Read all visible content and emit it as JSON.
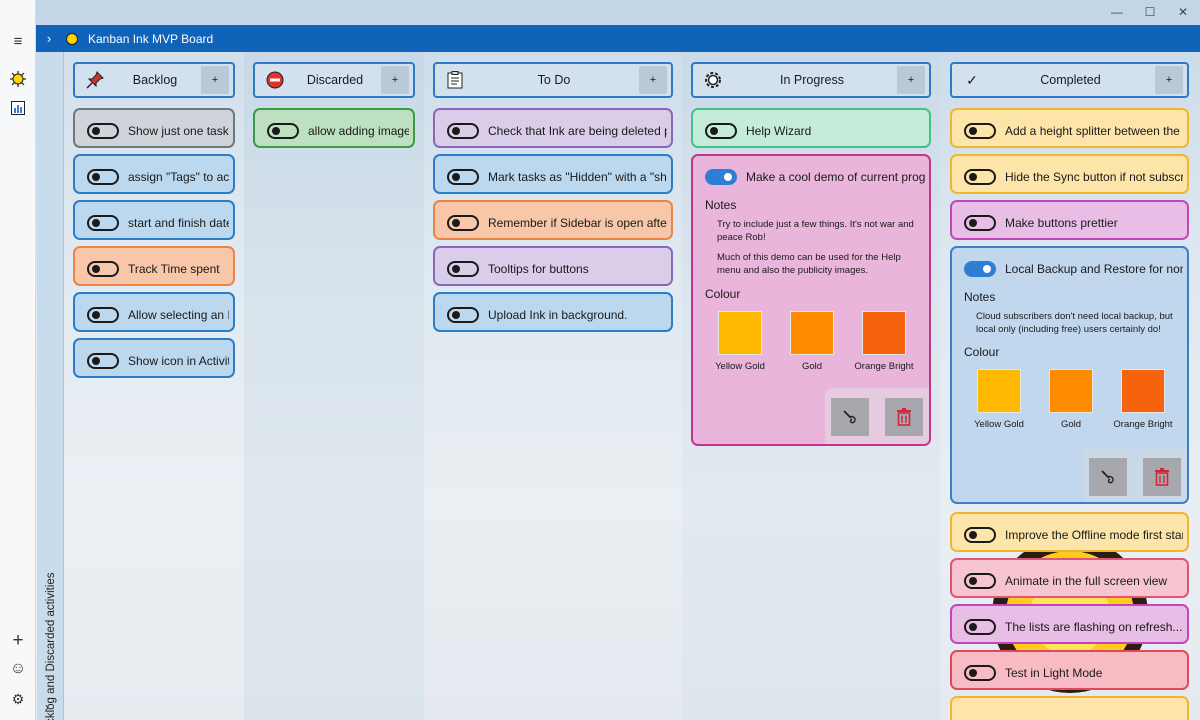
{
  "app": {
    "title": "Kanban Ink MVP Board"
  },
  "window_controls": {
    "minimize": "—",
    "maximize": "☐",
    "close": "✕"
  },
  "rail": {
    "menu_icon": "≡",
    "board_icon": "sun-icon",
    "chart_icon": "📊",
    "add_icon": "+",
    "emoji_icon": "☺",
    "settings_icon": "⚙"
  },
  "sidebar": {
    "label": "Backlog and Discarded activities",
    "chevron": "›"
  },
  "columns": {
    "backlog": {
      "title": "Backlog",
      "icon": "pin-icon",
      "add": "+"
    },
    "discarded": {
      "title": "Discarded",
      "icon": "no-entry-icon",
      "add": "+"
    },
    "todo": {
      "title": "To Do",
      "icon": "clipboard-icon",
      "add": "+"
    },
    "inprogress": {
      "title": "In Progress",
      "icon": "gear-icon",
      "add": "+"
    },
    "completed": {
      "title": "Completed",
      "icon": "✓",
      "add": "+"
    }
  },
  "backlog": [
    "Show just one task c",
    "assign \"Tags\" to acti",
    "start and finish dates",
    "Track Time spent",
    "Allow selecting an Ic",
    "Show icon in Activity"
  ],
  "discarded": [
    "allow adding images"
  ],
  "todo": [
    "Check that Ink are being deleted pro",
    "Mark tasks as \"Hidden\" with a \"show",
    "Remember if Sidebar is open after na",
    "Tooltips for buttons",
    "Upload Ink in background."
  ],
  "inprogress": {
    "task1": "Help Wizard",
    "task2": {
      "title": "Make a cool demo of current progres",
      "notes_label": "Notes",
      "notes_p1": "Try to include just a few things. It's not war and peace Rob!",
      "notes_p2": "Much of this demo can be used for the Help menu and also the publicity images.",
      "colour_label": "Colour",
      "swatches": [
        {
          "name": "Yellow Gold",
          "color": "#ffb900"
        },
        {
          "name": "Gold",
          "color": "#ff8c00"
        },
        {
          "name": "Orange Bright",
          "color": "#f7630c"
        }
      ]
    }
  },
  "completed": {
    "task1": "Add a height splitter between the ba",
    "task2": "Hide the Sync button if not subscribe",
    "task3": "Make buttons prettier",
    "task4": {
      "title": "Local Backup and Restore for non clc",
      "notes_label": "Notes",
      "notes_text": "Cloud subscribers don't need local backup, but local only (including free) users certainly do!",
      "colour_label": "Colour",
      "swatches": [
        {
          "name": "Yellow Gold",
          "color": "#ffb900"
        },
        {
          "name": "Gold",
          "color": "#ff8c00"
        },
        {
          "name": "Orange Bright",
          "color": "#f7630c"
        }
      ]
    },
    "task5": "Improve the Offline mode first start",
    "task6": "Animate in the full screen view",
    "task7": "The lists are flashing on refresh... fix t",
    "task8": "Test in Light Mode"
  },
  "colors": {
    "titlebar": "#0f63b8",
    "header_border": "#2d79c7",
    "header_bg": "#d3e1ee"
  }
}
